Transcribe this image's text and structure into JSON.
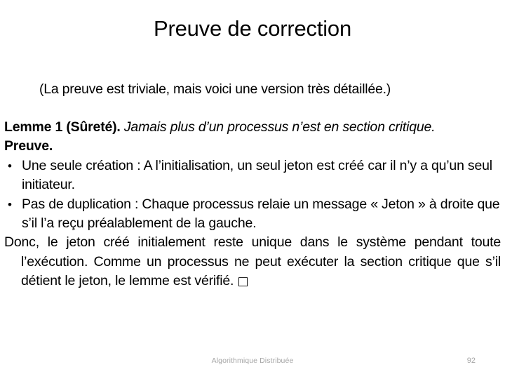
{
  "slide": {
    "title": "Preuve de correction",
    "subtitle": "(La preuve est triviale, mais voici une version très détaillée.)",
    "lemma": {
      "head": "Lemme 1 (Sûreté).",
      "statement": " Jamais plus d’un processus n’est en section critique."
    },
    "proof": {
      "label": "Preuve.",
      "bullets": [
        {
          "marker": "•",
          "text": "Une seule création : A l’initialisation, un seul jeton est créé car il n’y a qu’un seul initiateur."
        },
        {
          "marker": "•",
          "text": "Pas de duplication : Chaque processus relaie un message « Jeton » à droite que s’il l’a reçu préalablement de la gauche."
        }
      ],
      "conclusion": "Donc, le jeton créé initialement reste unique dans le système pendant toute l’exécution. Comme un processus ne peut exécuter la section critique que s’il détient le jeton, le lemme est vérifié. ",
      "qed_symbol": "□"
    },
    "footer": {
      "text": "Algorithmique Distribuée",
      "page_number": "92"
    },
    "colors": {
      "background": "#ffffff",
      "text": "#000000",
      "footer_text": "#a6a6a6"
    }
  }
}
